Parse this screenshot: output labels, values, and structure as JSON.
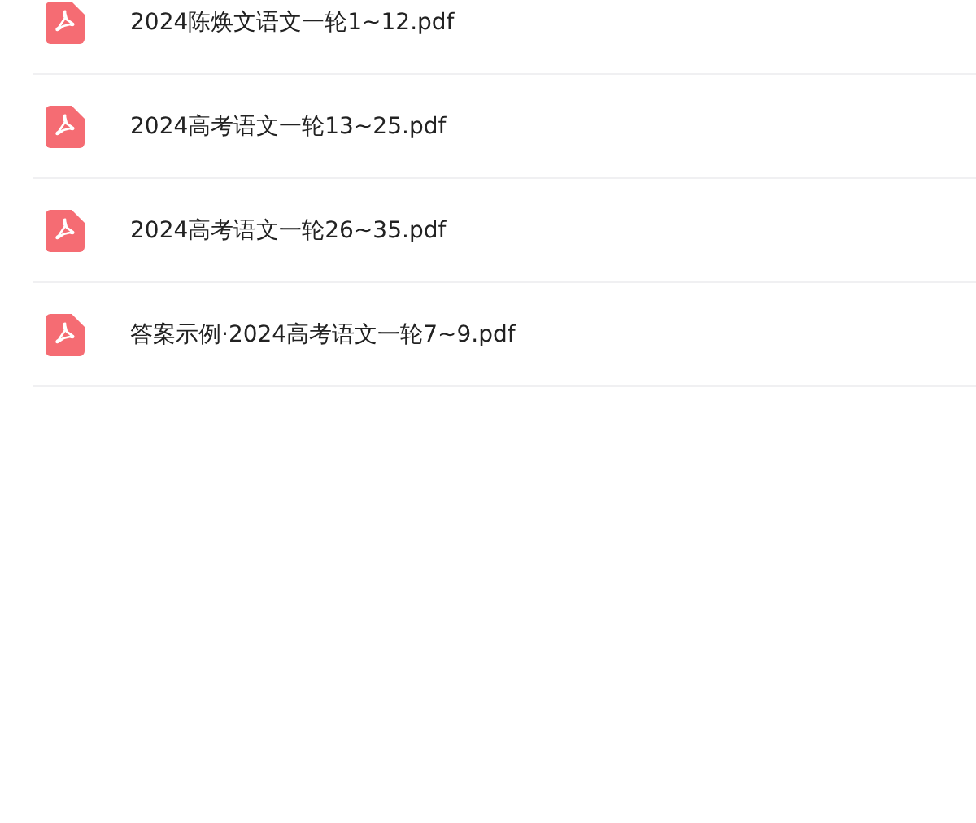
{
  "files": [
    {
      "kind": "pdf",
      "name": "2024陈焕文语文一轮1~12.pdf"
    },
    {
      "kind": "pdf",
      "name": "2024高考语文一轮13~25.pdf"
    },
    {
      "kind": "pdf",
      "name": "2024高考语文一轮26~35.pdf"
    },
    {
      "kind": "pdf",
      "name": "答案示例·2024高考语文一轮7~9.pdf"
    }
  ]
}
